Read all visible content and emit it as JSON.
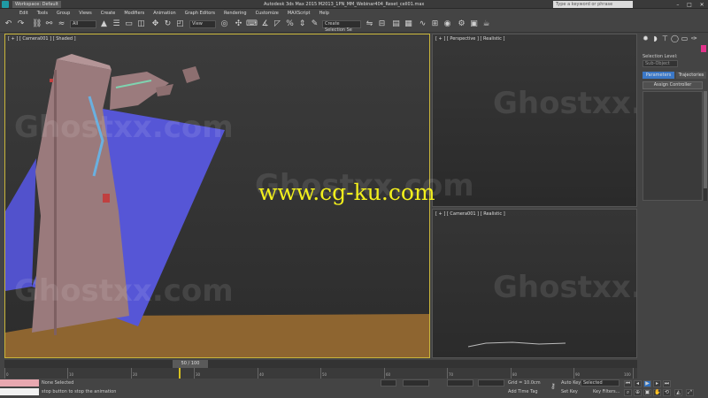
{
  "titlebar": {
    "workspace": "Workspace: Default",
    "title": "Autodesk 3ds Max 2015    M2013_1PN_MM_Webinar404_Reset_cell01.max",
    "search_placeholder": "Type a keyword or phrase",
    "min": "–",
    "max": "□",
    "close": "✕"
  },
  "menu": [
    "Edit",
    "Tools",
    "Group",
    "Views",
    "Create",
    "Modifiers",
    "Animation",
    "Graph Editors",
    "Rendering",
    "Customize",
    "MAXScript",
    "Help"
  ],
  "toolbar": {
    "undo": "↶",
    "redo": "↷",
    "filter_label": "All",
    "refcoord_label": "View",
    "selset_label": "Create Selection Se"
  },
  "viewports": {
    "main_label": "[ + ] [ Camera001 ] [ Shaded ]",
    "persp_label": "[ + ] [ Perspective ] [ Realistic ]",
    "cam2_label": "[ + ] [ Camera001 ] [ Realistic ]"
  },
  "command_panel": {
    "selection_level_label": "Selection Level:",
    "selection_level_value": "Sub-Object",
    "tab_parameters": "Parameters",
    "tab_trajectories": "Trajectories",
    "rollout_title": "Assign Controller"
  },
  "timeline": {
    "frame_display": "50 / 100",
    "ticks": [
      "0",
      "10",
      "20",
      "30",
      "40",
      "50",
      "60",
      "70",
      "80",
      "90",
      "100"
    ]
  },
  "status": {
    "selection": "None Selected",
    "prompt": "stop button to stop the animation",
    "grid": "Grid = 10.0cm",
    "add_time_tag": "Add Time Tag",
    "auto_key": "Auto Key",
    "set_key": "Set Key",
    "selected": "Selected",
    "key_filters": "Key Filters..."
  },
  "watermarks": {
    "ghost": "Ghostxx.com",
    "cgku": "www.cg-ku.com"
  },
  "colors": {
    "viewport_active_border": "#c9b53a",
    "accent_blue": "#3b78c7",
    "building": "#9a7a7c",
    "water_plane": "#5656d6",
    "ground": "#8e6530"
  }
}
